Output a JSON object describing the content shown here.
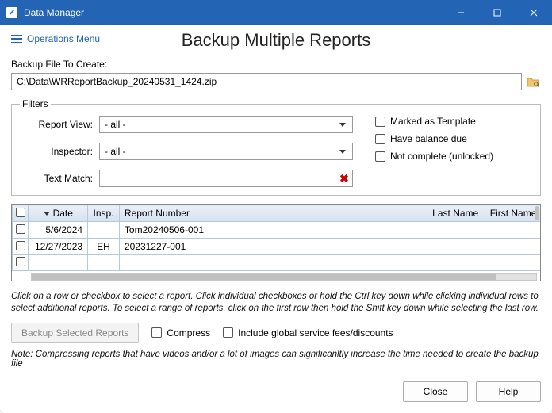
{
  "window": {
    "title": "Data Manager"
  },
  "ops_menu": "Operations Menu",
  "heading": "Backup Multiple Reports",
  "backup_file_label": "Backup File To Create:",
  "backup_file_value": "C:\\Data\\WRReportBackup_20240531_1424.zip",
  "filters": {
    "legend": "Filters",
    "report_view_label": "Report View:",
    "report_view_value": "- all -",
    "inspector_label": "Inspector:",
    "inspector_value": "- all -",
    "text_match_label": "Text Match:",
    "text_match_value": "",
    "marked_template": "Marked as Template",
    "have_balance": "Have balance due",
    "not_complete": "Not complete (unlocked)"
  },
  "grid": {
    "headers": {
      "date": "Date",
      "insp": "Insp.",
      "report_number": "Report Number",
      "last_name": "Last Name",
      "first_name": "First Name"
    },
    "rows": [
      {
        "date": "5/6/2024",
        "insp": "",
        "report_number": "Tom20240506-001",
        "last_name": "",
        "first_name": ""
      },
      {
        "date": "12/27/2023",
        "insp": "EH",
        "report_number": "20231227-001",
        "last_name": "",
        "first_name": ""
      }
    ]
  },
  "instruction": "Click on a row or checkbox to select a report. Click individual checkboxes or hold the Ctrl key down while clicking individual rows to select additional reports. To select a range of reports, click on the first row then hold the Shift key down while selecting the last row.",
  "backup_button": "Backup Selected Reports",
  "compress": "Compress",
  "include_fees": "Include global service fees/discounts",
  "note": "Note: Compressing reports that have videos and/or a lot of images can significanltly increase the time needed to create the backup file",
  "footer": {
    "close": "Close",
    "help": "Help"
  }
}
